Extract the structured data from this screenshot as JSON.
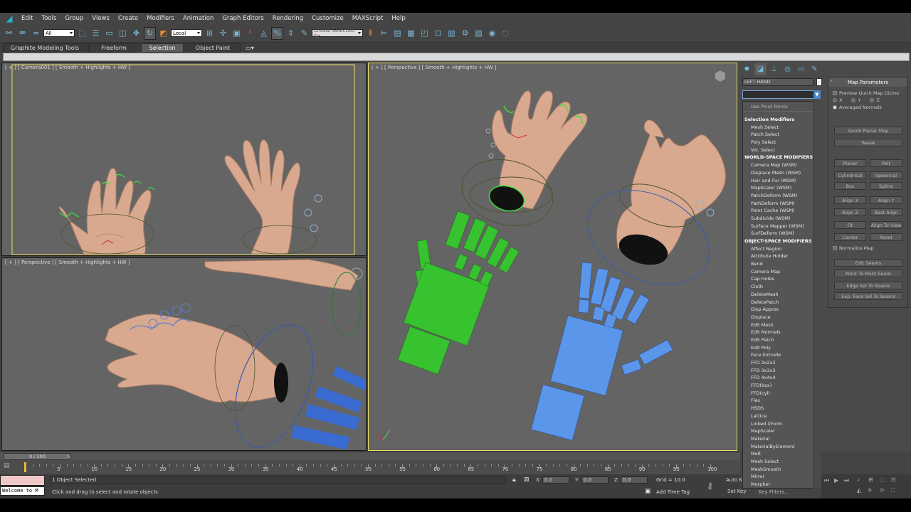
{
  "menus": [
    "Edit",
    "Tools",
    "Group",
    "Views",
    "Create",
    "Modifiers",
    "Animation",
    "Graph Editors",
    "Rendering",
    "Customize",
    "MAXScript",
    "Help"
  ],
  "toolbar": {
    "filter_value": "All",
    "coord_value": "Local",
    "named_selection_placeholder": "Create Selection Se"
  },
  "ribbon_tabs": [
    {
      "label": "Graphite Modeling Tools"
    },
    {
      "label": "Freeform"
    },
    {
      "label": "Selection"
    },
    {
      "label": "Object Paint"
    }
  ],
  "viewports": {
    "top_left": "[ + ] [ Camera001 ] [ Smooth + Highlights + HW ]",
    "bottom_left": "[ + ] [ Perspective ] [ Smooth + Highlights + HW ]",
    "right": "[ + ] [ Perspective ] [ Smooth + Highlights + HW ]"
  },
  "command_panel": {
    "object_name": "LEFT HAND",
    "use_pivot": "Use Pivot Points",
    "modifier_list": [
      {
        "type": "header",
        "label": "Selection Modifiers"
      },
      {
        "type": "item",
        "label": "Mesh Select"
      },
      {
        "type": "item",
        "label": "Patch Select"
      },
      {
        "type": "item",
        "label": "Poly Select"
      },
      {
        "type": "item",
        "label": "Vol. Select"
      },
      {
        "type": "header",
        "label": "WORLD-SPACE MODIFIERS"
      },
      {
        "type": "item",
        "label": "Camera Map (WSM)"
      },
      {
        "type": "item",
        "label": "Displace Mesh (WSM)"
      },
      {
        "type": "item",
        "label": "Hair and Fur (WSM)"
      },
      {
        "type": "item",
        "label": "MapScaler (WSM)"
      },
      {
        "type": "item",
        "label": "PatchDeform (WSM)"
      },
      {
        "type": "item",
        "label": "PathDeform (WSM)"
      },
      {
        "type": "item",
        "label": "Point Cache (WSM)"
      },
      {
        "type": "item",
        "label": "Subdivide (WSM)"
      },
      {
        "type": "item",
        "label": "Surface Mapper (WSM)"
      },
      {
        "type": "item",
        "label": "SurfDeform (WSM)"
      },
      {
        "type": "header",
        "label": "OBJECT-SPACE MODIFIERS"
      },
      {
        "type": "item",
        "label": "Affect Region"
      },
      {
        "type": "item",
        "label": "Attribute Holder"
      },
      {
        "type": "item",
        "label": "Bend"
      },
      {
        "type": "item",
        "label": "Camera Map"
      },
      {
        "type": "item",
        "label": "Cap Holes"
      },
      {
        "type": "item",
        "label": "Cloth"
      },
      {
        "type": "item",
        "label": "DeleteMesh"
      },
      {
        "type": "item",
        "label": "DeletePatch"
      },
      {
        "type": "item",
        "label": "Disp Approx"
      },
      {
        "type": "item",
        "label": "Displace"
      },
      {
        "type": "item",
        "label": "Edit Mesh"
      },
      {
        "type": "item",
        "label": "Edit Normals"
      },
      {
        "type": "item",
        "label": "Edit Patch"
      },
      {
        "type": "item",
        "label": "Edit Poly"
      },
      {
        "type": "item",
        "label": "Face Extrude"
      },
      {
        "type": "item",
        "label": "FFD 2x2x2"
      },
      {
        "type": "item",
        "label": "FFD 3x3x3"
      },
      {
        "type": "item",
        "label": "FFD 4x4x4"
      },
      {
        "type": "item",
        "label": "FFD(box)"
      },
      {
        "type": "item",
        "label": "FFD(cyl)"
      },
      {
        "type": "item",
        "label": "Flex"
      },
      {
        "type": "item",
        "label": "HSDS"
      },
      {
        "type": "item",
        "label": "Lattice"
      },
      {
        "type": "item",
        "label": "Linked XForm"
      },
      {
        "type": "item",
        "label": "MapScaler"
      },
      {
        "type": "item",
        "label": "Material"
      },
      {
        "type": "item",
        "label": "MaterialByElement"
      },
      {
        "type": "item",
        "label": "Melt"
      },
      {
        "type": "item",
        "label": "Mesh Select"
      },
      {
        "type": "item",
        "label": "MeshSmooth"
      },
      {
        "type": "item",
        "label": "Mirror"
      },
      {
        "type": "item",
        "label": "Morpher"
      }
    ]
  },
  "map_parameters": {
    "title": "Map Parameters",
    "preview": "Preview Quick Map Gizmo",
    "x": "X",
    "y": "Y",
    "z": "Z",
    "averaged_normals": "Averaged Normals",
    "quick_planar_map": "Quick Planar Map",
    "tweak": "Tweak",
    "planar": "Planar",
    "pelt": "Pelt",
    "cylindrical": "Cylindrical",
    "spherical": "Spherical",
    "box": "Box",
    "spline": "Spline",
    "align_x": "Align X",
    "align_y": "Align Y",
    "align_z": "Align Z",
    "best_align": "Best Align",
    "fit": "Fit",
    "align_to_view": "Align To View",
    "center": "Center",
    "reset": "Reset",
    "normalize_map": "Normalize Map",
    "edit_seams": "Edit Seams",
    "point_to_point_seam": "Point To Point Seam",
    "edge_sel_to_seams": "Edge Sel To Seams",
    "exp_face_sel_to_seams": "Exp. Face Sel To Seams"
  },
  "timeline": {
    "slider": "0 / 100",
    "ticks": [
      "0",
      "5",
      "10",
      "15",
      "20",
      "25",
      "30",
      "35",
      "40",
      "45",
      "50",
      "55",
      "60",
      "65",
      "70",
      "75",
      "80",
      "85",
      "90",
      "95",
      "100"
    ]
  },
  "status": {
    "welcome": "Welcome to M",
    "selected": "1 Object Selected",
    "prompt": "Click and drag to select and rotate objects",
    "x_label": "X:",
    "x_value": "0.0",
    "y_label": "Y:",
    "y_value": "0.0",
    "z_label": "Z:",
    "z_value": "0.0",
    "grid": "Grid = 10.0",
    "add_time_tag": "Add Time Tag",
    "auto_key": "Auto K",
    "set_key": "Set Key",
    "key_filters": "Key Filters..."
  }
}
